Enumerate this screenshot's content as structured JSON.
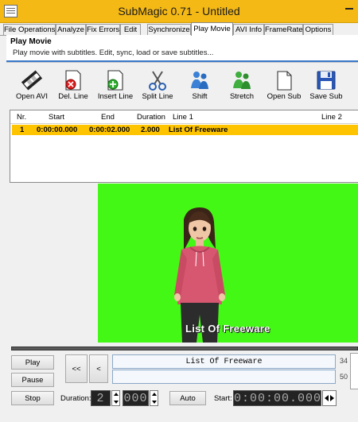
{
  "window": {
    "title": "SubMagic 0.71 - Untitled"
  },
  "tabs": [
    {
      "label": "File Operations"
    },
    {
      "label": "Analyze"
    },
    {
      "label": "Fix Errors"
    },
    {
      "label": "Edit"
    },
    {
      "label": "Synchronize"
    },
    {
      "label": "Play Movie",
      "active": true
    },
    {
      "label": "AVI Info"
    },
    {
      "label": "FrameRate"
    },
    {
      "label": "Options"
    }
  ],
  "header": {
    "title": "Play Movie",
    "description": "Play movie with subtitles. Edit, sync, load or save subtitles..."
  },
  "toolbar": [
    {
      "label": "Open AVI",
      "icon": "film-strip-icon"
    },
    {
      "label": "Del. Line",
      "icon": "delete-line-icon"
    },
    {
      "label": "Insert Line",
      "icon": "insert-line-icon"
    },
    {
      "label": "Split Line",
      "icon": "scissors-icon"
    },
    {
      "label": "Shift",
      "icon": "shift-people-icon"
    },
    {
      "label": "Stretch",
      "icon": "stretch-people-icon"
    },
    {
      "label": "Open Sub",
      "icon": "open-document-icon"
    },
    {
      "label": "Save Sub",
      "icon": "floppy-disk-icon"
    }
  ],
  "subtitle_table": {
    "columns": [
      "Nr.",
      "Start",
      "End",
      "Duration",
      "Line 1",
      "Line 2"
    ],
    "rows": [
      {
        "nr": "1",
        "start": "0:00:00.000",
        "end": "0:00:02.000",
        "duration": "2.000",
        "line1": "List Of Freeware",
        "line2": "",
        "selected": true
      }
    ]
  },
  "video": {
    "subtitle_overlay": "List Of Freeware",
    "background_color": "#44f815"
  },
  "controls": {
    "play": "Play",
    "pause": "Pause",
    "stop": "Stop",
    "rewind_fast": "<<",
    "rewind": "<",
    "subtitle_line1": "List Of Freeware",
    "subtitle_line2": "",
    "line1_count": "34",
    "line2_count": "50",
    "duration_label": "Duration:",
    "duration_seconds": "2",
    "duration_ms": "000",
    "auto": "Auto",
    "start_label": "Start:",
    "start_time": "0:00:00.000"
  },
  "colors": {
    "title_bar": "#f5b916",
    "selection": "#ffc400",
    "accent_line": "#3a78c9"
  }
}
